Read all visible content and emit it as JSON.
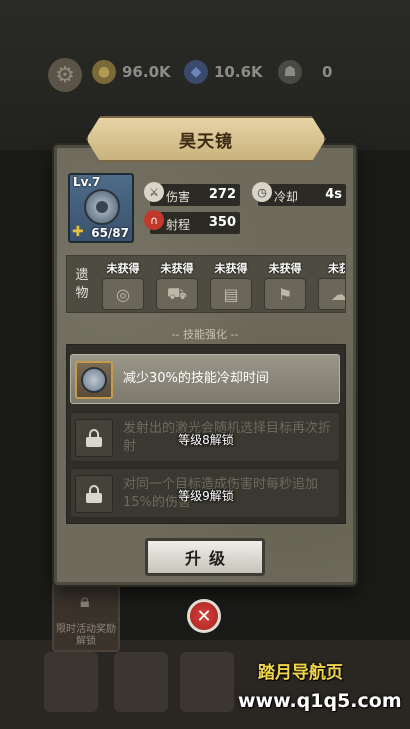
{
  "topbar": {
    "gold": "96.0K",
    "gems": "10.6K",
    "energy": "0"
  },
  "event_card": {
    "label": "限时活动奖励解锁"
  },
  "dialog": {
    "title": "昊天镜",
    "weapon": {
      "level": "Lv.7",
      "progress": "65/87"
    },
    "stats": {
      "damage_label": "伤害",
      "damage_value": "272",
      "cooldown_label": "冷却",
      "cooldown_value": "4s",
      "range_label": "射程",
      "range_value": "350"
    },
    "relics": {
      "label_1": "遗",
      "label_2": "物",
      "items": [
        "未获得",
        "未获得",
        "未获得",
        "未获得",
        "未获"
      ]
    },
    "section_title": "-- 技能强化 --",
    "skills": [
      {
        "text": "减少30%的技能冷却时间",
        "unlock": ""
      },
      {
        "text": "发射出的激光会随机选择目标再次折射",
        "unlock": "等级8解锁"
      },
      {
        "text": "对同一个目标造成伤害时每秒追加15%的伤害",
        "unlock": "等级9解锁"
      }
    ],
    "upgrade_label": "升级"
  },
  "watermark": {
    "line1": "踏月导航页",
    "line2": "www.q1q5.com"
  },
  "colors": {
    "accent_gold": "#f0d54a",
    "close_red": "#c2302b",
    "panel": "#6e6b5c"
  }
}
